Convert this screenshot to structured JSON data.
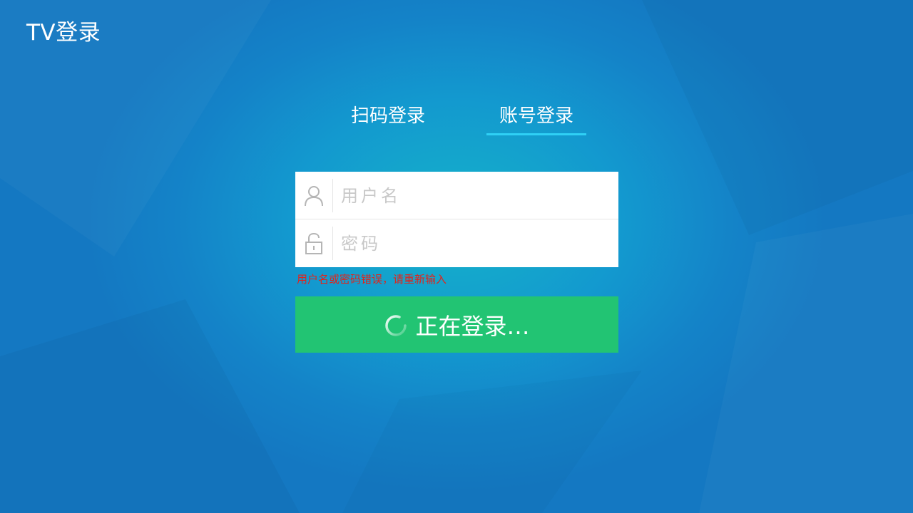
{
  "app": {
    "title": "TV登录"
  },
  "tabs": [
    {
      "label": "扫码登录",
      "active": false
    },
    {
      "label": "账号登录",
      "active": true
    }
  ],
  "form": {
    "username": {
      "placeholder": "用户名",
      "value": "",
      "icon": "user-icon"
    },
    "password": {
      "placeholder": "密码",
      "value": "",
      "icon": "unlock-icon"
    }
  },
  "error": {
    "message": "用户名或密码错误，请重新输入",
    "color": "#e2231a"
  },
  "login_button": {
    "label": "正在登录…",
    "icon": "loading-spinner-icon",
    "color": "#22c473"
  },
  "colors": {
    "accent": "#2fd0f5",
    "background": "#1483c8"
  }
}
